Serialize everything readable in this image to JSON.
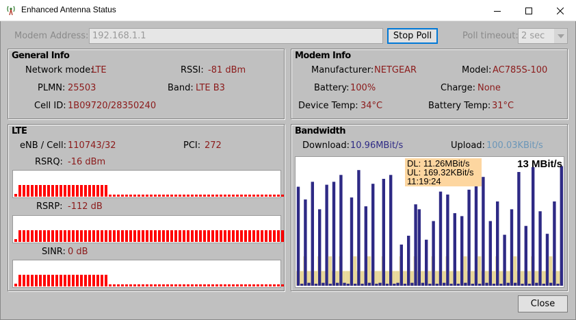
{
  "window": {
    "title": "Enhanced Antenna Status"
  },
  "toolbar": {
    "modem_address_label": "Modem Address:",
    "modem_address_value": "192.168.1.1",
    "stop_poll_label": "Stop Poll",
    "poll_timeout_label": "Poll timeout:",
    "poll_timeout_value": "2 sec"
  },
  "general": {
    "title": "General Info",
    "network_mode_label": "Network mode:",
    "network_mode_value": "LTE",
    "rssi_label": "RSSI:",
    "rssi_value": "-81 dBm",
    "plmn_label": "PLMN:",
    "plmn_value": "25503",
    "band_label": "Band:",
    "band_value": "LTE B3",
    "cellid_label": "Cell ID:",
    "cellid_value": "1B09720/28350240"
  },
  "modem": {
    "title": "Modem Info",
    "manufacturer_label": "Manufacturer:",
    "manufacturer_value": "NETGEAR",
    "model_label": "Model:",
    "model_value": "AC785S-100",
    "battery_label": "Battery:",
    "battery_value": "100%",
    "charge_label": "Charge:",
    "charge_value": "None",
    "devtemp_label": "Device Temp:",
    "devtemp_value": "34°C",
    "battemp_label": "Battery Temp:",
    "battemp_value": "31°C"
  },
  "lte": {
    "title": "LTE",
    "enb_label": "eNB / Cell:",
    "enb_value": "110743/32",
    "pci_label": "PCI:",
    "pci_value": "272",
    "rsrq_label": "RSRQ:",
    "rsrq_value": "-16 dBm",
    "rsrp_label": "RSRP:",
    "rsrp_value": "-112 dB",
    "sinr_label": "SINR:",
    "sinr_value": "0 dB",
    "bar_color": "#ff0000"
  },
  "bandwidth": {
    "title": "Bandwidth",
    "download_label": "Download:",
    "download_value": "10.96MBit/s",
    "upload_label": "Upload:",
    "upload_value": "100.03KBit/s",
    "download_color": "#2e2a85",
    "upload_color": "#6b96b8",
    "scale_label": "13 MBit/s",
    "tooltip_dl": "DL: 11.26MBit/s",
    "tooltip_ul": "UL: 169.32KBit/s",
    "tooltip_time": "11:19:24"
  },
  "footer": {
    "close_label": "Close"
  },
  "chart_data": {
    "type": "bar",
    "ylim": [
      0,
      13
    ],
    "series": [
      {
        "name": "Download",
        "values": [
          10.1,
          0.2,
          8.8,
          0.3,
          10.6,
          0.2,
          7.8,
          0.3,
          10.3,
          0.2,
          10.6,
          0.3,
          11.3,
          0.3,
          0.2,
          9.0,
          0.2,
          11.8,
          0.2,
          8.1,
          0.3,
          10.4,
          0.2,
          0.3,
          10.9,
          0.2,
          11.3,
          0.2,
          0.3,
          4.2,
          0.2,
          5.1,
          0.3,
          8.3,
          7.8,
          0.3,
          4.7,
          0.2,
          6.6,
          0.2,
          9.6,
          0.3,
          9.3,
          0.2,
          7.4,
          0.2,
          7.1,
          0.3,
          9.8,
          0.2,
          10.6,
          0.2,
          11.1,
          0.3,
          6.6,
          0.2,
          8.6,
          0.2,
          5.2,
          0.3,
          7.8,
          0.3,
          11.6,
          0.2,
          6.1,
          0.2,
          12.1,
          0.3,
          7.6,
          0.2,
          5.3,
          0.3,
          8.6,
          0.2,
          12.2
        ]
      },
      {
        "name": "Upload",
        "values": [
          0.1,
          0.1,
          0.2,
          0.1,
          0.1,
          0.1,
          0.2,
          0.1,
          0.1,
          0.2,
          0.1,
          0.1,
          0.2,
          0.1,
          0.1,
          0.1,
          0.2,
          0.1,
          0.1,
          0.1,
          0.2,
          0.1,
          0.1,
          0.1,
          0.2,
          0.1,
          0.1,
          0.1,
          0.1,
          0.2,
          0.1,
          0.1,
          0.1,
          0.2,
          0.1,
          0.1,
          0.1,
          0.1,
          0.2,
          0.1,
          0.1,
          0.1,
          0.2,
          0.1,
          0.1,
          0.1,
          0.1,
          0.2,
          0.1,
          0.1,
          0.1,
          0.2,
          0.1,
          0.1,
          0.1,
          0.1,
          0.2,
          0.1,
          0.1,
          0.1,
          0.1,
          0.2,
          0.1,
          0.1,
          0.1,
          0.1,
          0.2,
          0.1,
          0.1,
          0.1,
          0.1,
          0.2,
          0.1,
          0.1,
          0.1,
          0.2
        ]
      }
    ]
  },
  "signal_bars": {
    "rsrq": {
      "level_fraction": 0.35
    },
    "rsrp": {
      "level_fraction": 1.0
    },
    "sinr": {
      "level_fraction": 0.35
    }
  }
}
